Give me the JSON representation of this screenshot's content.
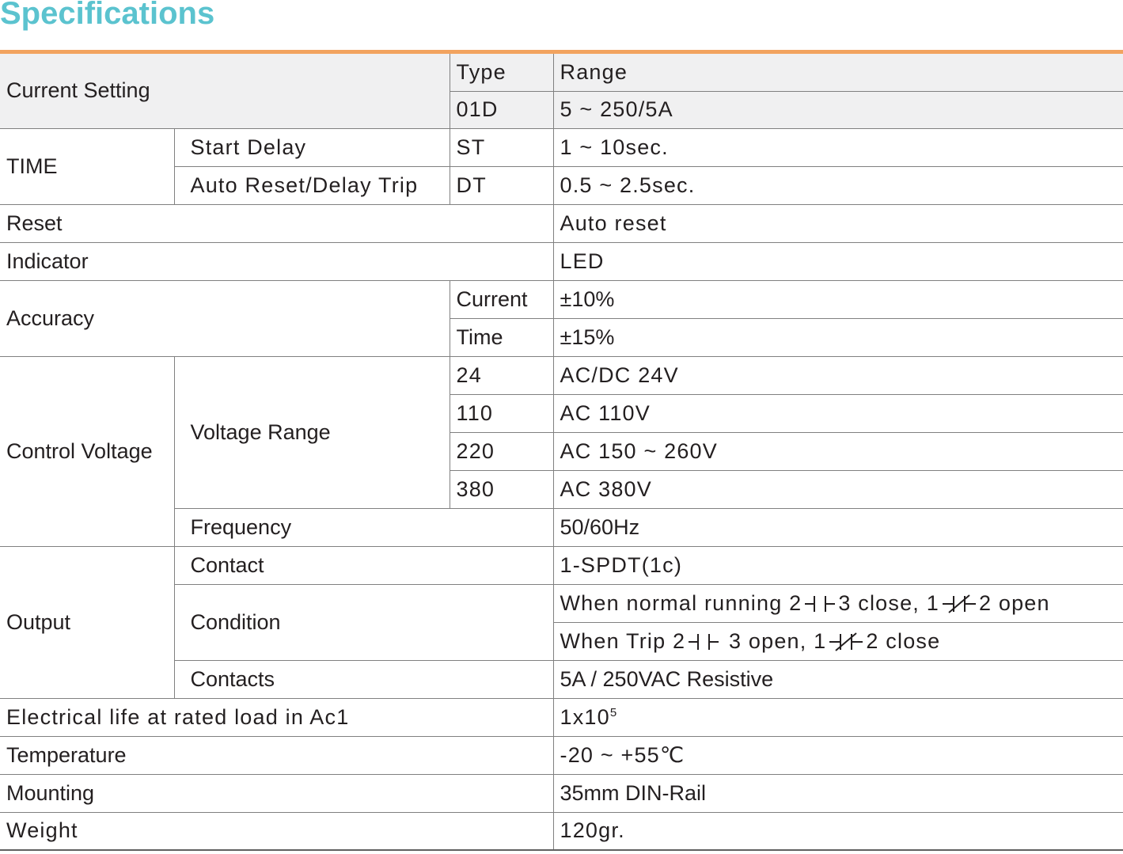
{
  "title": "Specifications",
  "rows": {
    "current_setting": {
      "label": "Current Setting",
      "type_header": "Type",
      "range_header": "Range",
      "type": "01D",
      "range": "5 ~ 250/5A"
    },
    "time": {
      "label": "TIME",
      "start_delay": {
        "label": "Start Delay",
        "type": "ST",
        "value": "1 ~ 10sec."
      },
      "delay_trip": {
        "label": "Auto Reset/Delay Trip",
        "type": "DT",
        "value": "0.5 ~ 2.5sec."
      }
    },
    "reset": {
      "label": "Reset",
      "value": "Auto reset"
    },
    "indicator": {
      "label": "Indicator",
      "value": "LED"
    },
    "accuracy": {
      "label": "Accuracy",
      "current": {
        "label": "Current",
        "value": "±10%"
      },
      "time": {
        "label": "Time",
        "value": "±15%"
      }
    },
    "control_voltage": {
      "label": "Control Voltage",
      "voltage_range_label": "Voltage Range",
      "ranges": [
        {
          "code": "24",
          "value": "AC/DC 24V"
        },
        {
          "code": "110",
          "value": "AC 110V"
        },
        {
          "code": "220",
          "value": "AC 150 ~ 260V"
        },
        {
          "code": "380",
          "value": "AC 380V"
        }
      ],
      "frequency": {
        "label": "Frequency",
        "value": "50/60Hz"
      }
    },
    "output": {
      "label": "Output",
      "contact": {
        "label": "Contact",
        "value": "1-SPDT(1c)"
      },
      "condition": {
        "label": "Condition",
        "normal": {
          "prefix": "When normal running  2",
          "mid": "3 close, 1",
          "suffix": "2 open"
        },
        "trip": {
          "prefix": "When Trip 2",
          "mid": " 3 open, 1",
          "suffix": "2 close"
        }
      },
      "contacts": {
        "label": "Contacts",
        "value": "5A / 250VAC Resistive"
      }
    },
    "electrical_life": {
      "label": "Electrical life at rated load in Ac1",
      "base": "1x10",
      "exponent": "5"
    },
    "temperature": {
      "label": "Temperature",
      "value": "-20 ~ +55℃"
    },
    "mounting": {
      "label": "Mounting",
      "value": "35mm DIN-Rail"
    },
    "weight": {
      "label": "Weight",
      "value": "120gr."
    }
  }
}
